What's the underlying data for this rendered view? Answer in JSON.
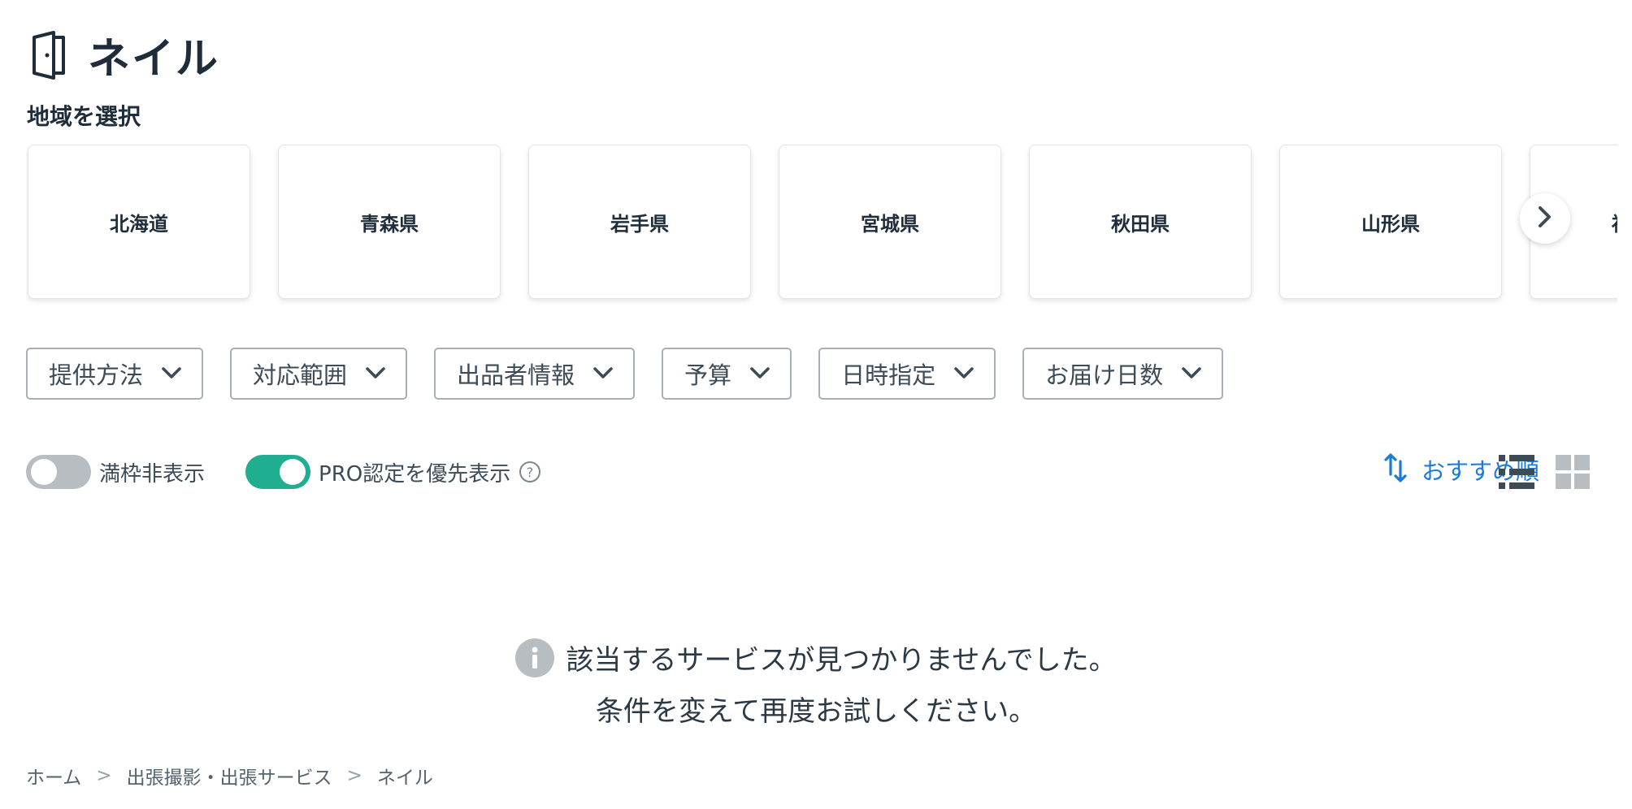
{
  "header": {
    "title": "ネイル",
    "icon": "door-icon"
  },
  "region": {
    "label": "地域を選択",
    "items": [
      "北海道",
      "青森県",
      "岩手県",
      "宮城県",
      "秋田県",
      "山形県",
      "福島県"
    ],
    "next_icon": "chevron-right-icon"
  },
  "filters": [
    "提供方法",
    "対応範囲",
    "出品者情報",
    "予算",
    "日時指定",
    "お届け日数"
  ],
  "toggles": {
    "hide_full": {
      "label": "満枠非表示",
      "on": false
    },
    "pro_first": {
      "label": "PRO認定を優先表示",
      "on": true
    }
  },
  "sort": {
    "label": "おすすめ順",
    "icon": "sort-icon"
  },
  "view_modes": [
    "list-view-icon",
    "grid-view-icon"
  ],
  "empty_state": {
    "line1": "該当するサービスが見つかりませんでした。",
    "line2": "条件を変えて再度お試しください。"
  },
  "breadcrumb": [
    "ホーム",
    "出張撮影・出張サービス",
    "ネイル"
  ],
  "colors": {
    "accent_green": "#1fae90",
    "link_blue": "#1d7ad8",
    "text": "#1f2d3a"
  }
}
